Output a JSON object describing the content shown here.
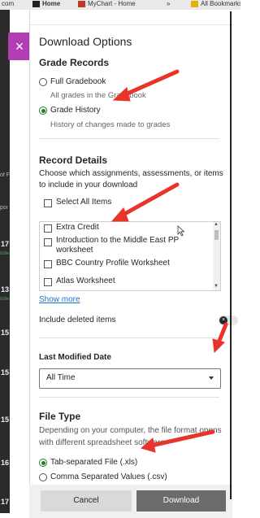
{
  "browser": {
    "left_tab": "com",
    "tab_home": "Home",
    "tab_mychart": "MyChart - Home",
    "overflow": "»",
    "bookmarks": "All Bookmarks"
  },
  "background": {
    "left_label_a": "of F",
    "left_label_b": "poi",
    "nums": [
      "17",
      "13",
      "15",
      "15",
      "15",
      "16",
      "17"
    ],
    "green_label": "oste"
  },
  "dialog": {
    "title": "Download Options",
    "close_glyph": "×",
    "grade_records": {
      "title": "Grade Records",
      "options": [
        {
          "label": "Full Gradebook",
          "desc": "All grades in the Gradebook",
          "selected": false
        },
        {
          "label": "Grade History",
          "desc": "History of changes made to grades",
          "selected": true
        }
      ]
    },
    "record_details": {
      "title": "Record Details",
      "desc_line1": "Choose which assignments, assessments, or items",
      "desc_line2": "to include in your download",
      "select_all": "Select All Items",
      "items": [
        "Extra Credit",
        "Introduction to the Middle East PP worksheet",
        "BBC Country Profile Worksheet",
        "Atlas Worksheet"
      ],
      "show_more": "Show more",
      "include_deleted": "Include deleted items",
      "toggle_glyph": "×"
    },
    "last_modified": {
      "title": "Last Modified Date",
      "value": "All Time"
    },
    "file_type": {
      "title": "File Type",
      "desc_line1": "Depending on your computer, the file format opens",
      "desc_line2": "with different spreadsheet software",
      "options": [
        {
          "label": "Tab-separated File (.xls)",
          "selected": true
        },
        {
          "label": "Comma Separated Values (.csv)",
          "selected": false
        }
      ]
    },
    "buttons": {
      "cancel": "Cancel",
      "download": "Download"
    }
  },
  "colors": {
    "accent_purple": "#b13fb3",
    "radio_green": "#2a7a2a",
    "arrow_red": "#e8342b",
    "link_blue": "#1c6fd1"
  }
}
